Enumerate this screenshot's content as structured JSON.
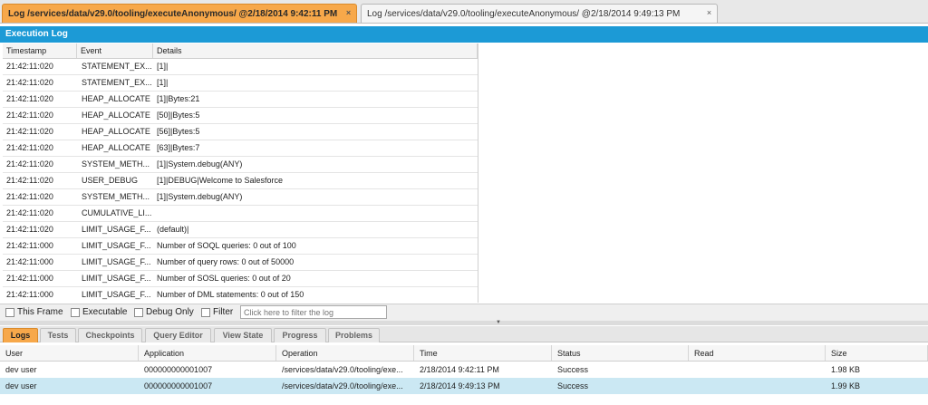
{
  "tabs": [
    {
      "label": "Log /services/data/v29.0/tooling/executeAnonymous/ @2/18/2014 9:42:11 PM",
      "close": "×"
    },
    {
      "label": "Log /services/data/v29.0/tooling/executeAnonymous/ @2/18/2014 9:49:13 PM",
      "close": "×"
    }
  ],
  "execution_log": {
    "title": "Execution Log",
    "columns": [
      "Timestamp",
      "Event",
      "Details"
    ],
    "rows": [
      [
        "21:42:11:020",
        "STATEMENT_EX...",
        "[1]|"
      ],
      [
        "21:42:11:020",
        "STATEMENT_EX...",
        "[1]|"
      ],
      [
        "21:42:11:020",
        "HEAP_ALLOCATE",
        "[1]|Bytes:21"
      ],
      [
        "21:42:11:020",
        "HEAP_ALLOCATE",
        "[50]|Bytes:5"
      ],
      [
        "21:42:11:020",
        "HEAP_ALLOCATE",
        "[56]|Bytes:5"
      ],
      [
        "21:42:11:020",
        "HEAP_ALLOCATE",
        "[63]|Bytes:7"
      ],
      [
        "21:42:11:020",
        "SYSTEM_METH...",
        "[1]|System.debug(ANY)"
      ],
      [
        "21:42:11:020",
        "USER_DEBUG",
        "[1]|DEBUG|Welcome to Salesforce"
      ],
      [
        "21:42:11:020",
        "SYSTEM_METH...",
        "[1]|System.debug(ANY)"
      ],
      [
        "21:42:11:020",
        "CUMULATIVE_LI...",
        ""
      ],
      [
        "21:42:11:020",
        "LIMIT_USAGE_F...",
        "(default)|"
      ],
      [
        "21:42:11:000",
        "LIMIT_USAGE_F...",
        "Number of SOQL queries: 0 out of 100"
      ],
      [
        "21:42:11:000",
        "LIMIT_USAGE_F...",
        "Number of query rows: 0 out of 50000"
      ],
      [
        "21:42:11:000",
        "LIMIT_USAGE_F...",
        "Number of SOSL queries: 0 out of 20"
      ],
      [
        "21:42:11:000",
        "LIMIT_USAGE_F...",
        "Number of DML statements: 0 out of 150"
      ],
      [
        "21:42:11:000",
        "LIMIT_USAGE_F...",
        "Number of DML rows: 0 out of 10000"
      ]
    ]
  },
  "filters": {
    "this_frame": "This Frame",
    "executable": "Executable",
    "debug_only": "Debug Only",
    "filter": "Filter",
    "filter_placeholder": "Click here to filter the log"
  },
  "bottom_tabs": [
    "Logs",
    "Tests",
    "Checkpoints",
    "Query Editor",
    "View State",
    "Progress",
    "Problems"
  ],
  "active_bottom_tab": "Logs",
  "logs_table": {
    "columns": [
      "User",
      "Application",
      "Operation",
      "Time",
      "Status",
      "Read",
      "Size"
    ],
    "rows": [
      [
        "dev user",
        "000000000001007",
        "/services/data/v29.0/tooling/exe...",
        "2/18/2014 9:42:11 PM",
        "Success",
        "",
        "1.98 KB"
      ],
      [
        "dev user",
        "000000000001007",
        "/services/data/v29.0/tooling/exe...",
        "2/18/2014 9:49:13 PM",
        "Success",
        "",
        "1.99 KB"
      ]
    ]
  },
  "colors": {
    "active_tab": "#f7a84a",
    "header_blue": "#1c9ad6",
    "selected_row": "#cbe8f3"
  }
}
